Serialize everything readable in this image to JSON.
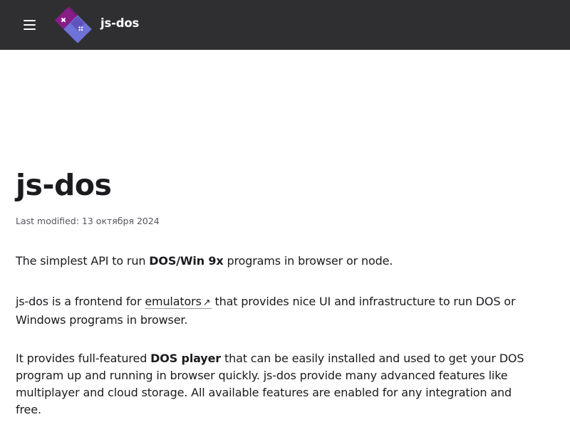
{
  "header": {
    "brand": "js-dos",
    "colors": {
      "background": "#2f2f32",
      "logo_primary": "#7b1a7e",
      "logo_secondary": "#6f72d8"
    },
    "icons": {
      "menu": "hamburger-menu-icon",
      "logo": "js-dos-logo"
    }
  },
  "page": {
    "title": "js-dos",
    "last_modified": "Last modified: 13 октября 2024",
    "p1": {
      "before": "The simplest API to run ",
      "bold": "DOS/Win 9x",
      "after": " programs in browser or node."
    },
    "p2": {
      "before": "js-dos is a frontend for ",
      "link": "emulators",
      "link_icon": "↗",
      "after": " that provides nice UI and infrastructure to run DOS or Windows programs in browser."
    },
    "p3": {
      "before": "It provides full-featured ",
      "bold": "DOS player",
      "after": " that can be easily installed and used to get your DOS program up and running in browser quickly. js-dos provide many advanced features like multiplayer and cloud storage. All available features are enabled for any integration and free."
    }
  }
}
